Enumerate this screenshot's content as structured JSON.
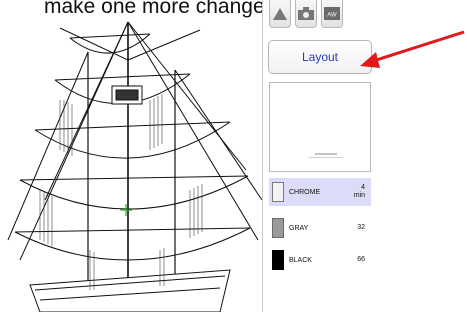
{
  "caption": "make one more change to the des",
  "toolbar": {
    "icons": [
      "triangle-icon",
      "camera-icon",
      "film-icon"
    ],
    "film_label": "AW"
  },
  "layout_button": {
    "label": "Layout"
  },
  "colors": [
    {
      "name": "CHROME",
      "value": "4",
      "unit": "min",
      "selected": true,
      "hex": "#f2f2f2"
    },
    {
      "name": "GRAY",
      "value": "32",
      "unit": "",
      "selected": false,
      "hex": "#9a9a9a"
    },
    {
      "name": "BLACK",
      "value": "66",
      "unit": "",
      "selected": false,
      "hex": "#000000"
    }
  ],
  "accent_colors": {
    "arrow": "#e01b1b",
    "selection": "#dcdcf8",
    "button_text": "#2a38b8"
  }
}
